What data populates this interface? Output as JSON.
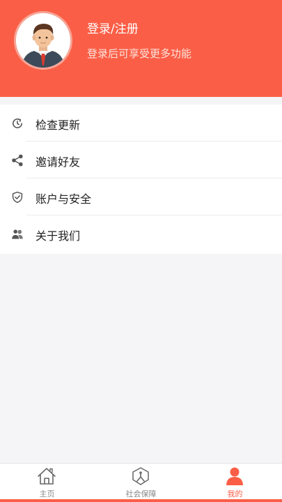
{
  "profile": {
    "title": "登录/注册",
    "subtitle": "登录后可享受更多功能",
    "avatar_icon": "avatar-man-icon"
  },
  "menu": {
    "items": [
      {
        "label": "检查更新",
        "icon": "clock-refresh-icon"
      },
      {
        "label": "邀请好友",
        "icon": "share-icon"
      },
      {
        "label": "账户与安全",
        "icon": "shield-check-icon"
      },
      {
        "label": "关于我们",
        "icon": "users-icon"
      }
    ]
  },
  "tabbar": {
    "tabs": [
      {
        "label": "主页",
        "icon": "home-icon",
        "active": false
      },
      {
        "label": "社会保障",
        "icon": "social-security-icon",
        "active": false
      },
      {
        "label": "我的",
        "icon": "person-icon",
        "active": true
      }
    ]
  },
  "colors": {
    "accent": "#fb5e46",
    "text": "#222222",
    "muted": "#888888",
    "background": "#f5f5f7"
  }
}
